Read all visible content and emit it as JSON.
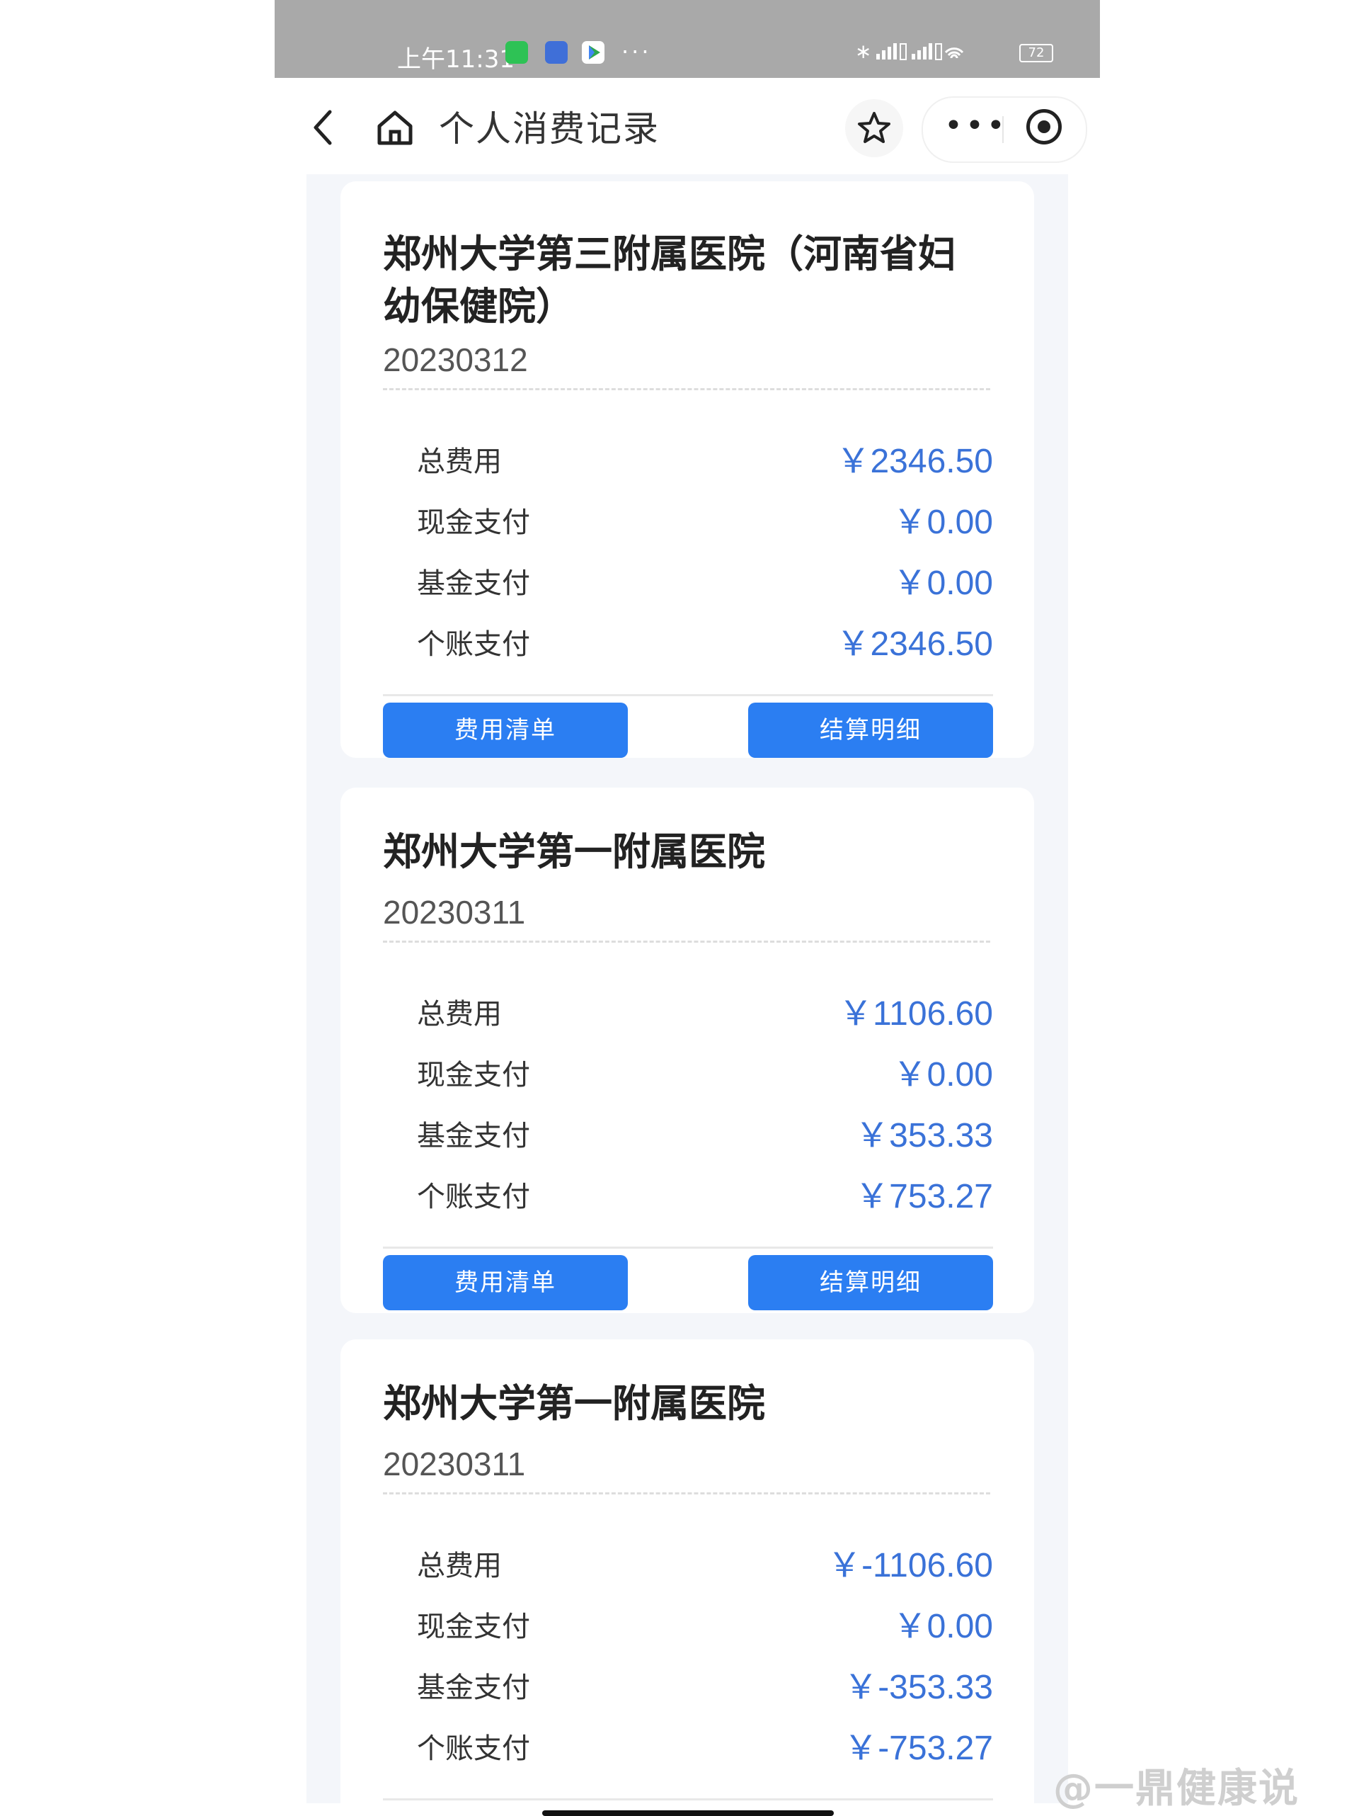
{
  "status_bar": {
    "time": "上午11:31",
    "more": "···",
    "battery": "72",
    "app_icons": [
      "wechat-icon",
      "monitor-icon",
      "play-icon"
    ],
    "system_icons": [
      "bluetooth-icon",
      "signal-icon",
      "signal-icon",
      "wifi-icon",
      "battery-icon"
    ]
  },
  "nav": {
    "title": "个人消费记录",
    "more": "•••"
  },
  "records": [
    {
      "hospital": "郑州大学第三附属医院（河南省妇幼保健院）",
      "date": "20230312",
      "items": [
        {
          "label": "总费用",
          "value": "￥2346.50"
        },
        {
          "label": "现金支付",
          "value": "￥0.00"
        },
        {
          "label": "基金支付",
          "value": "￥0.00"
        },
        {
          "label": "个账支付",
          "value": "￥2346.50"
        }
      ],
      "buttons": {
        "list": "费用清单",
        "detail": "结算明细"
      }
    },
    {
      "hospital": "郑州大学第一附属医院",
      "date": "20230311",
      "items": [
        {
          "label": "总费用",
          "value": "￥1106.60"
        },
        {
          "label": "现金支付",
          "value": "￥0.00"
        },
        {
          "label": "基金支付",
          "value": "￥353.33"
        },
        {
          "label": "个账支付",
          "value": "￥753.27"
        }
      ],
      "buttons": {
        "list": "费用清单",
        "detail": "结算明细"
      }
    },
    {
      "hospital": "郑州大学第一附属医院",
      "date": "20230311",
      "items": [
        {
          "label": "总费用",
          "value": "￥-1106.60"
        },
        {
          "label": "现金支付",
          "value": "￥0.00"
        },
        {
          "label": "基金支付",
          "value": "￥-353.33"
        },
        {
          "label": "个账支付",
          "value": "￥-753.27"
        }
      ]
    }
  ],
  "watermark": "@一鼎健康说",
  "colors": {
    "accent": "#2b7ef2",
    "amount": "#3a72d8",
    "status_bar": "#a9a9a9",
    "background": "#f4f6fa"
  }
}
